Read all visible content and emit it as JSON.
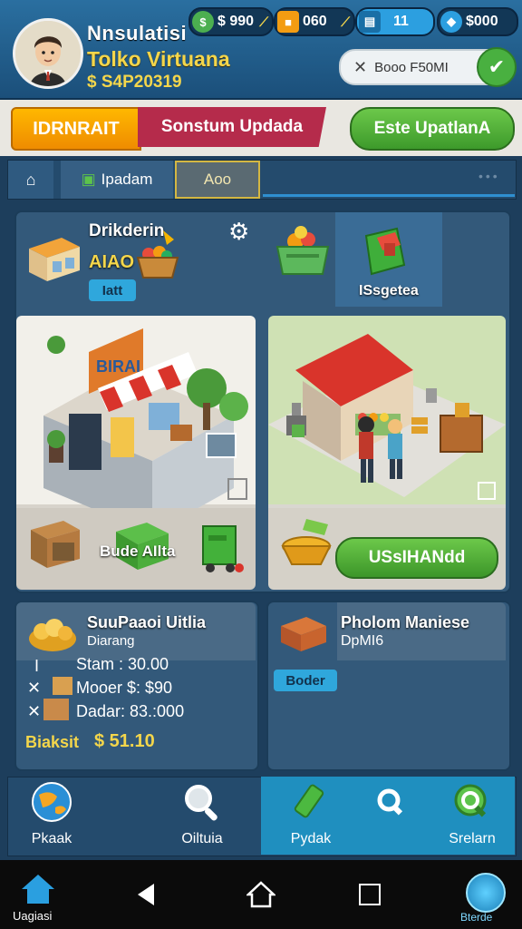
{
  "header": {
    "player_name": "Nnsulatisi",
    "game_title": "Tolko Virtuana",
    "money": "$ S4P20319"
  },
  "resources": [
    {
      "value": "$ 990",
      "color": "#4caf50"
    },
    {
      "value": "060",
      "color": "#f39c12"
    },
    {
      "value": "11",
      "color": "#2c9fe0"
    },
    {
      "value": "$000",
      "color": "#2c9fe0"
    }
  ],
  "search": {
    "text": "Booo F50MI"
  },
  "banner": {
    "left": "IDRNRAIT",
    "middle": "Sonstum Updada",
    "button": "Este UpatlanA"
  },
  "tabs": {
    "update": "Ipadam",
    "add": "Aoo"
  },
  "store_panel": {
    "title": "Drikderin",
    "subtitle": "AIAO",
    "tag": "Iatt",
    "market_label": "ISsgetea",
    "sign_text": "BIRAI",
    "strip_label": "Bude AIlta",
    "use_button": "USsIHANdd"
  },
  "info_left": {
    "title": "SuuPaaoi Uitlia",
    "subtitle": "Diarang",
    "stat1": "Stam : 30.00",
    "stat2": "Mooer $: $90",
    "stat3": "Dadar: 83.:000",
    "total_label": "Biaksit",
    "total_value": "$ 51.10"
  },
  "info_right": {
    "title": "Pholom Maniese",
    "subtitle": "DpMI6",
    "badge": "Boder"
  },
  "nav": [
    {
      "label": "Pkaak"
    },
    {
      "label": "Oiltuia"
    },
    {
      "label": "Pydak"
    },
    {
      "label": ""
    },
    {
      "label": "Srelarn"
    }
  ],
  "system_bar": {
    "left_label": "Uagiasi",
    "right_label": "Bterde"
  }
}
